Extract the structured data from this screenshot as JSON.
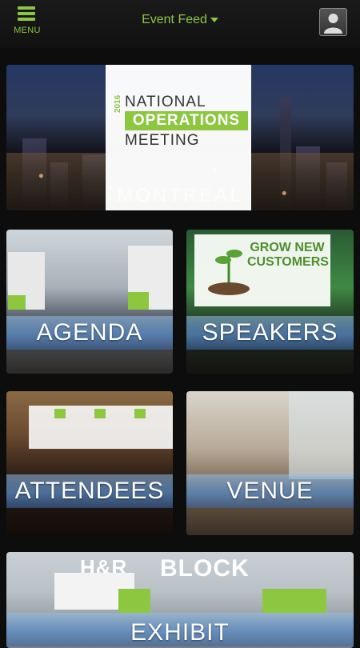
{
  "header": {
    "menu_label": "MENU",
    "title": "Event Feed"
  },
  "hero": {
    "logo_year": "2016",
    "logo_line1": "NATIONAL",
    "logo_line2": "OPERATIONS",
    "logo_line3": "MEETING",
    "city": "MONTREAL"
  },
  "tiles": [
    {
      "label": "AGENDA"
    },
    {
      "label": "SPEAKERS",
      "slide_text": "GROW NEW CUSTOMERS"
    },
    {
      "label": "ATTENDEES"
    },
    {
      "label": "VENUE"
    },
    {
      "label": "EXHIBIT",
      "sign_left": "H&R",
      "sign_right": "BLOCK"
    }
  ],
  "colors": {
    "accent": "#8dc63f",
    "background": "#0d0d0d"
  }
}
